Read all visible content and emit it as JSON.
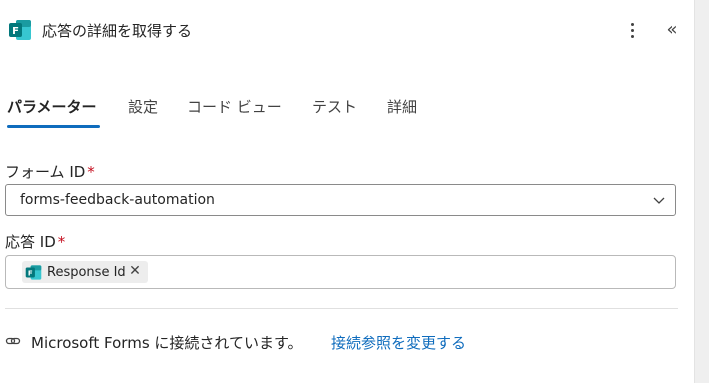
{
  "header": {
    "title": "応答の詳細を取得する",
    "app_icon": "microsoft-forms-icon",
    "more_icon": "more-vertical-icon",
    "collapse_icon": "double-chevron-left-icon"
  },
  "tabs": [
    {
      "label": "パラメーター",
      "active": true
    },
    {
      "label": "設定",
      "active": false
    },
    {
      "label": "コード ビュー",
      "active": false
    },
    {
      "label": "テスト",
      "active": false
    },
    {
      "label": "詳細",
      "active": false
    }
  ],
  "form_id": {
    "label": "フォーム ID",
    "required_mark": "*",
    "value": "forms-feedback-automation"
  },
  "response_id": {
    "label": "応答 ID",
    "required_mark": "*",
    "token_label": "Response Id",
    "token_close": "✕"
  },
  "connection": {
    "text": "Microsoft Forms に接続されています。",
    "link": "接続参照を変更する"
  },
  "colors": {
    "accent": "#0f6cbd",
    "required": "#c50f1f",
    "forms_green": "#03787c"
  }
}
